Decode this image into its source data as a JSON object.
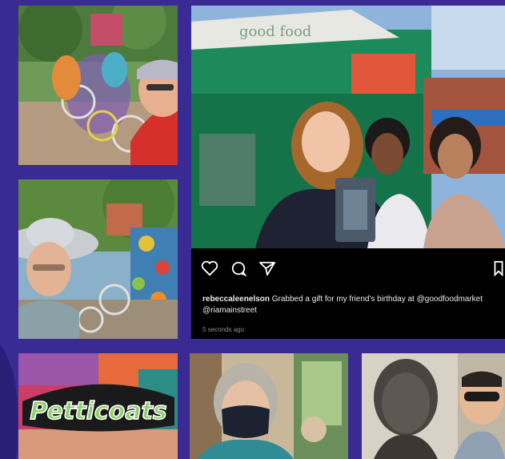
{
  "post": {
    "username": "rebeccaleenelson",
    "caption": "Grabbed a gift for my friend's birthday at @goodfoodmarket @riamainstreet",
    "time": "5 seconds ago",
    "storefront_sign": "good food"
  },
  "mural_text": "Petticoats",
  "icons": [
    "heart-icon",
    "comment-icon",
    "share-icon",
    "bookmark-icon"
  ],
  "colors": {
    "background": "#3a2a93",
    "card": "#000000"
  }
}
